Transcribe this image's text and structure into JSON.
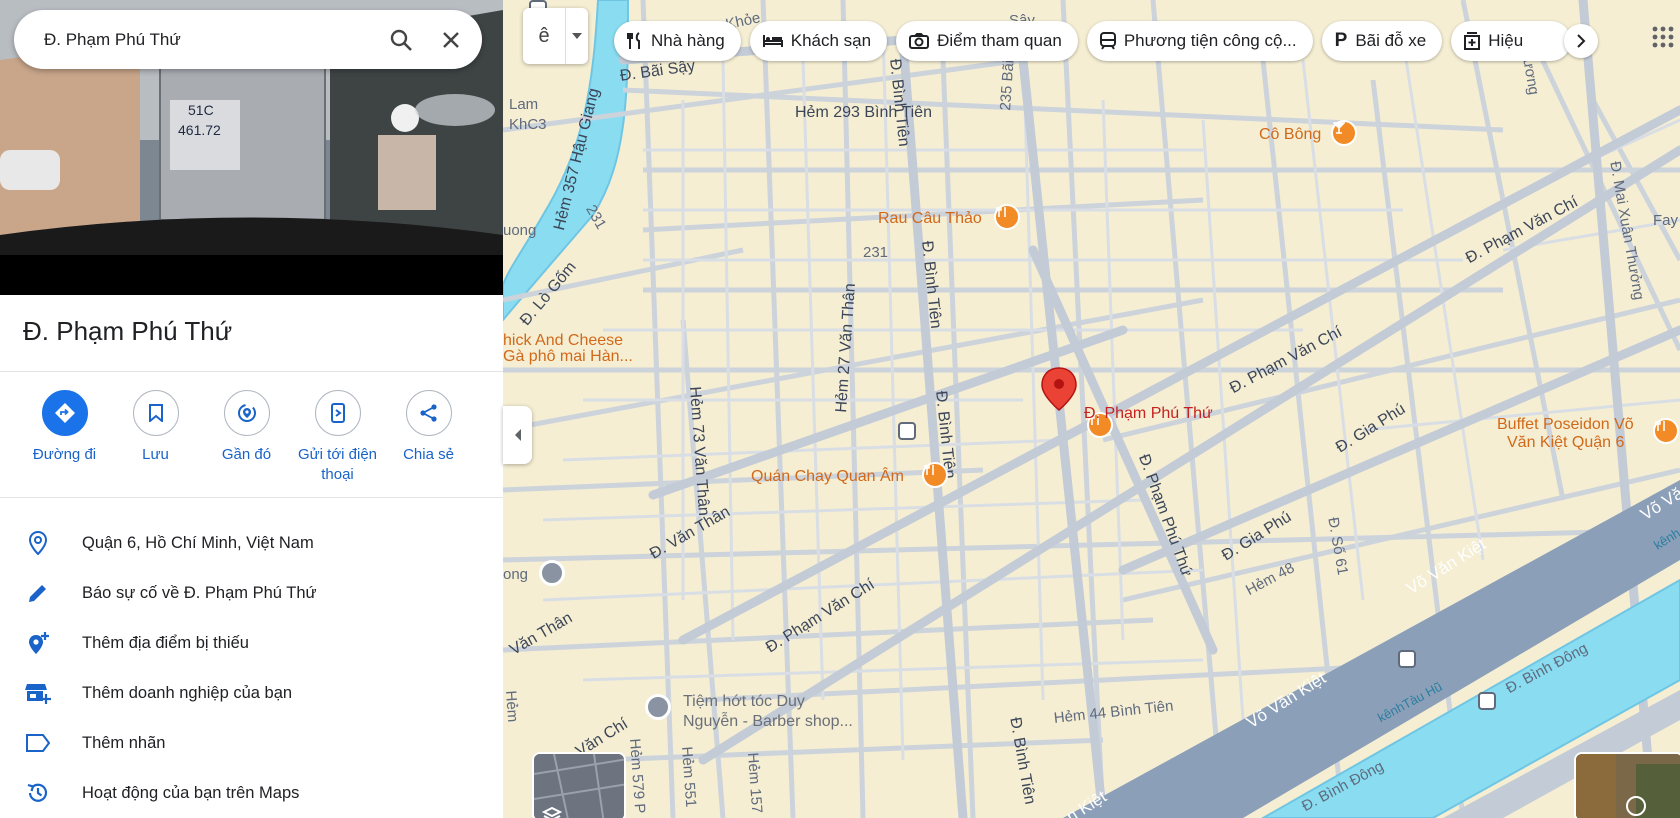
{
  "search": {
    "value": "Đ. Phạm Phú Thứ"
  },
  "place": {
    "title": "Đ. Phạm Phú Thứ"
  },
  "hero": {
    "plate_line1": "51C",
    "plate_line2": "461.72"
  },
  "actions": [
    {
      "label": "Đường đi",
      "icon": "directions-icon"
    },
    {
      "label": "Lưu",
      "icon": "bookmark-icon"
    },
    {
      "label": "Gần đó",
      "icon": "nearby-icon"
    },
    {
      "label": "Gửi tới điện thoại",
      "icon": "send-to-phone-icon"
    },
    {
      "label": "Chia sẻ",
      "icon": "share-icon"
    }
  ],
  "info": [
    {
      "text": "Quận 6, Hồ Chí Minh, Việt Nam",
      "icon": "location-pin-icon"
    },
    {
      "text": "Báo sự cố về Đ. Phạm Phú Thứ",
      "icon": "pencil-icon"
    },
    {
      "text": "Thêm địa điểm bị thiếu",
      "icon": "add-place-icon"
    },
    {
      "text": "Thêm doanh nghiệp của bạn",
      "icon": "add-business-icon"
    },
    {
      "text": "Thêm nhãn",
      "icon": "label-icon"
    },
    {
      "text": "Hoạt động của bạn trên Maps",
      "icon": "history-icon"
    }
  ],
  "map": {
    "layer_label": "ê",
    "chips": [
      {
        "label": "Nhà hàng",
        "icon": "restaurant-icon"
      },
      {
        "label": "Khách sạn",
        "icon": "hotel-icon"
      },
      {
        "label": "Điểm tham quan",
        "icon": "camera-icon"
      },
      {
        "label": "Phương tiện công cộ...",
        "icon": "transit-icon"
      },
      {
        "label": "Bãi đỗ xe",
        "icon": "parking-icon"
      },
      {
        "label": "Hiệu",
        "icon": "pharmacy-icon"
      }
    ],
    "streets": {
      "bai_say": "Đ. Bãi Sậy",
      "hem_293": "Hẻm 293 Bình Tiên",
      "hem_357": "Hẻm 357 Hậu Giang",
      "lo_gom": "Đ. Lò Gốm",
      "binh_tien_1": "Đ. Bình Tiên",
      "binh_tien_2": "Đ. Bình Tiên",
      "binh_tien_3": "Đ. Bình Tiên",
      "binh_tien_4": "Đ. Bình Tiên",
      "hem_27": "Hẻm 27 Văn Thân",
      "hem_73": "Hẻm 73 Văn Thân",
      "van_than_1": "Đ. Văn Thân",
      "van_than_2": "Văn Thân",
      "pvc_1": "Đ. Phạm Văn Chí",
      "pvc_2": "Đ. Phạm Văn Chí",
      "pvc_3": "Đ. Phạm Văn Chí",
      "pvc_4": "Văn Chí",
      "ppt": "Đ. Phạm Phú Thứ",
      "gia_phu_1": "Đ. Gia Phú",
      "gia_phu_2": "Đ. Gia Phú",
      "hem_48": "Hẻm 48",
      "so_61": "Đ. Số 61",
      "vvk_1": "Võ Văn Kiệt",
      "vvk_2": "Võ Văn Kiệt",
      "vvk_3": "Võ Văn",
      "vvk_4": "n Kiệt",
      "binh_dong_1": "Đ. Bình Đông",
      "binh_dong_2": "Đ. Bình Đông",
      "kenh": "kênhTàu Hũ",
      "kenh2": "kênh",
      "hem_44": "Hẻm 44 Bình Tiên",
      "mai_xuan_thuong": "Đ. Mai Xuân Thưởng",
      "n231a": "231",
      "n231b": "231",
      "n235": "235 Bãi",
      "lam": "Lam",
      "khc3": "KhC3",
      "uong": "uong",
      "ong": "ong",
      "hem_579": "Hẻm 579 P",
      "hem_551": "Hẻm 551",
      "hem_157": "Hẻm 157",
      "hem_l": "Hẻm",
      "khoe": "Hẻm Khỏe",
      "say": "Sậy",
      "fay": "Fay",
      "thuong": "Thương"
    },
    "pois": {
      "co_bong": "Cô Bông",
      "rau_cau": "Rau Câu Thảo",
      "chick_1": "hick And Cheese",
      "chick_2": "Gà phô mai Hàn...",
      "quan_chay": "Quán Chay Quan Âm",
      "buffet_1": "Buffet Poseidon Võ",
      "buffet_2": "Văn Kiệt Quận 6",
      "tiem_1": "Tiệm hớt tóc Duy",
      "tiem_2": "Nguyễn - Barber shop...",
      "selected": "Đ. Phạm Phú Thứ"
    }
  }
}
